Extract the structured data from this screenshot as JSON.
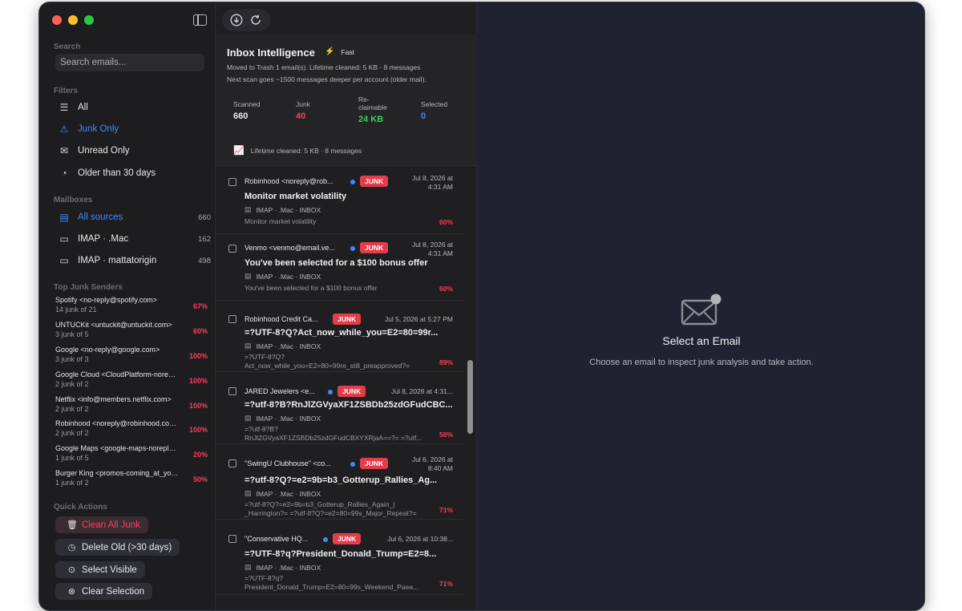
{
  "sidebar": {
    "search_label": "Search",
    "search_placeholder": "Search emails...",
    "filters_title": "Filters",
    "filters": [
      {
        "label": "All",
        "icon": "list-icon"
      },
      {
        "label": "Junk Only",
        "icon": "warning-icon"
      },
      {
        "label": "Unread Only",
        "icon": "envelope-icon"
      },
      {
        "label": "Older than 30 days",
        "icon": "clock-icon"
      }
    ],
    "mailboxes_title": "Mailboxes",
    "mailboxes": [
      {
        "label": "All sources",
        "count": "660",
        "icon": "tray-icon"
      },
      {
        "label": "IMAP · .Mac",
        "count": "162",
        "icon": "server-icon"
      },
      {
        "label": "IMAP · mattatorigin",
        "count": "498",
        "icon": "server-icon"
      }
    ],
    "top_senders_title": "Top Junk Senders",
    "top_senders": [
      {
        "name": "Spotify <no-reply@spotify.com>",
        "count": "14 junk of 21",
        "pct": "67%"
      },
      {
        "name": "UNTUCKit <untuckit@untuckit.com>",
        "count": "3 junk of 5",
        "pct": "60%"
      },
      {
        "name": "Google <no-reply@google.com>",
        "count": "3 junk of 3",
        "pct": "100%"
      },
      {
        "name": "Google Cloud <CloudPlatform-noreply@google.com>",
        "count": "2 junk of 2",
        "pct": "100%"
      },
      {
        "name": "Netflix <info@members.netflix.com>",
        "count": "2 junk of 2",
        "pct": "100%"
      },
      {
        "name": "Robinhood <noreply@robinhood.com>",
        "count": "2 junk of 2",
        "pct": "100%"
      },
      {
        "name": "Google Maps <google-maps-noreply@google.com>",
        "count": "1 junk of 5",
        "pct": "20%"
      },
      {
        "name": "Burger King <promos-coming_at_you@bk.com>",
        "count": "1 junk of 2",
        "pct": "50%"
      }
    ],
    "quick_actions_title": "Quick Actions",
    "quick_actions": [
      {
        "label": "Clean All Junk",
        "icon": "trash-icon"
      },
      {
        "label": "Delete Old (>30 days)",
        "icon": "clock-delete-icon"
      },
      {
        "label": "Select Visible",
        "icon": "check-circle-icon"
      },
      {
        "label": "Clear Selection",
        "icon": "x-circle-icon"
      }
    ]
  },
  "header": {
    "title": "Inbox Intelligence",
    "speed": "Fast",
    "status_line1": "Moved to Trash 1 email(s). Lifetime cleaned: 5 KB · 8 messages",
    "status_line2": "Next scan goes ~1500 messages deeper per account (older mail).",
    "stats": [
      {
        "label": "Scanned",
        "value": "660",
        "color": "#ececf0"
      },
      {
        "label": "Junk",
        "value": "40",
        "color": "#ff3b5c"
      },
      {
        "label": "Re-\nclaimable",
        "value": "24 KB",
        "color": "#35d05a"
      },
      {
        "label": "Selected",
        "value": "0",
        "color": "#3d8bfd"
      }
    ],
    "lifetime": "Lifetime cleaned: 5 KB · 8 messages"
  },
  "emails": [
    {
      "from": "Robinhood <noreply@rob...",
      "date": "Jul 8, 2026 at\n4:31 AM",
      "badge": "JUNK",
      "subject": "Monitor market volatility",
      "source": "IMAP · .Mac · INBOX",
      "preview": "Monitor market volatility",
      "score": "60%",
      "unread": true
    },
    {
      "from": "Venmo <venmo@email.ve...",
      "date": "Jul 8, 2026 at\n4:31 AM",
      "badge": "JUNK",
      "subject": "You've been selected for a $100 bonus offer",
      "source": "IMAP · .Mac · INBOX",
      "preview": "You've been selected for a $100 bonus offer",
      "score": "60%",
      "unread": true
    },
    {
      "from": "Robinhood Credit Ca...",
      "date": "Jul 5, 2026 at 5:27 PM",
      "badge": "JUNK",
      "subject": "=?UTF-8?Q?Act_now_while_you=E2=80=99r...",
      "source": "IMAP · .Mac · INBOX",
      "preview": "=?UTF-8?Q?\nAct_now_while_you=E2=80=99re_still_preapproved?=",
      "score": "89%",
      "unread": false
    },
    {
      "from": "JARED Jewelers <e...",
      "date": "Jul 8, 2026 at 4:31...",
      "badge": "JUNK",
      "subject": "=?utf-8?B?RnJlZGVyaXF1ZSBDb25zdGFudCBC...",
      "source": "IMAP · .Mac · INBOX",
      "preview": "=?utf-8?B?\nRnJlZGVyaXF1ZSBDb25zdGFudCBXYXRjaA==?= =?utf...",
      "score": "58%",
      "unread": true
    },
    {
      "from": "\"SwingU Clubhouse\" <co...",
      "date": "Jul 6, 2026 at\n8:40 AM",
      "badge": "JUNK",
      "subject": "=?utf-8?Q?=e2=9b=b3_Gotterup_Rallies_Ag...",
      "source": "IMAP · .Mac · INBOX",
      "preview": "=?utf-8?Q?=e2=9b=b3_Gotterup_Rallies_Again_|\n_Harrington?= =?utf-8?Q?=e2=80=99s_Major_Repeat?=",
      "score": "71%",
      "unread": true
    },
    {
      "from": "\"Conservative HQ...",
      "date": "Jul 6, 2026 at 10:38...",
      "badge": "JUNK",
      "subject": "=?UTF-8?q?President_Donald_Trump=E2=8...",
      "source": "IMAP · .Mac · INBOX",
      "preview": "=?UTF-8?q?\nPresident_Donald_Trump=E2=80=99s_Weekend_Paea...",
      "score": "71%",
      "unread": true
    }
  ],
  "detail": {
    "empty_title": "Select an Email",
    "empty_subtitle": "Choose an email to inspect junk analysis and take action."
  },
  "colors": {
    "accent": "#3d8bfd",
    "junk_badge": "#e33c4b",
    "danger_text": "#ff3b5c",
    "reclaim": "#35d05a"
  }
}
